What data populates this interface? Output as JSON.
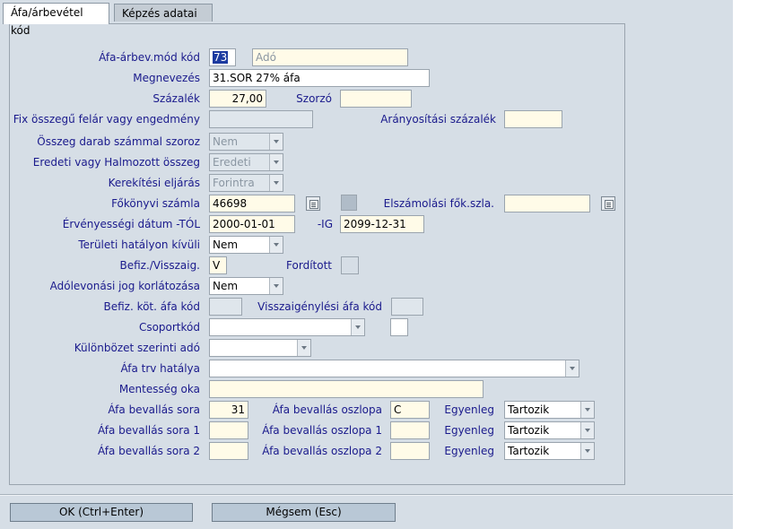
{
  "tabs": [
    {
      "label": "Áfa/árbevétel kód",
      "active": true
    },
    {
      "label": "Képzés adatai",
      "active": false
    }
  ],
  "form": {
    "afa_kod": {
      "label": "Áfa-árbev.mód kód",
      "value": "73",
      "type_value": "Adó"
    },
    "megnevezes": {
      "label": "Megnevezés",
      "value": "31.SOR 27% áfa"
    },
    "szazalek": {
      "label": "Százalék",
      "value": "27,00"
    },
    "szorzo": {
      "label": "Szorzó",
      "value": ""
    },
    "fix_osszegu": {
      "label": "Fix összegű felár vagy engedmény",
      "value": ""
    },
    "aranyositasi": {
      "label": "Arányosítási százalék",
      "value": ""
    },
    "osszeg_darab": {
      "label": "Összeg darab számmal szoroz",
      "value": "Nem"
    },
    "eredeti_halmozott": {
      "label": "Eredeti vagy Halmozott összeg",
      "value": "Eredeti"
    },
    "kerekitesi": {
      "label": "Kerekítési eljárás",
      "value": "Forintra"
    },
    "fokonyvi": {
      "label": "Főkönyvi számla",
      "value": "46698"
    },
    "elszamolasi": {
      "label": "Elszámolási fők.szla.",
      "value": ""
    },
    "ervenyesseg": {
      "label": "Érvényességi dátum -TÓL",
      "from": "2000-01-01",
      "to_label": "-IG",
      "to": "2099-12-31"
    },
    "teruleti": {
      "label": "Területi hatályon kívüli",
      "value": "Nem"
    },
    "befiz_visszaig": {
      "label": "Befiz./Visszaig.",
      "value": "V"
    },
    "forditott": {
      "label": "Fordított"
    },
    "adolevonasi": {
      "label": "Adólevonási jog korlátozása",
      "value": "Nem"
    },
    "befiz_kot": {
      "label": "Befiz. köt. áfa kód",
      "value": ""
    },
    "visszaigenylesi": {
      "label": "Visszaigénylési áfa kód",
      "value": ""
    },
    "csoportkod": {
      "label": "Csoportkód",
      "value": ""
    },
    "kulonbozet": {
      "label": "Különbözet szerinti adó",
      "value": ""
    },
    "afa_trv": {
      "label": "Áfa trv hatálya",
      "value": ""
    },
    "mentesseg": {
      "label": "Mentesség oka",
      "value": ""
    },
    "bevallas_rows": [
      {
        "sora_label": "Áfa bevallás sora",
        "sora": "31",
        "oszlopa_label": "Áfa bevallás oszlopa",
        "oszlopa": "C",
        "egyenleg_label": "Egyenleg",
        "egyenleg": "Tartozik"
      },
      {
        "sora_label": "Áfa bevallás sora 1",
        "sora": "",
        "oszlopa_label": "Áfa bevallás oszlopa 1",
        "oszlopa": "",
        "egyenleg_label": "Egyenleg",
        "egyenleg": "Tartozik"
      },
      {
        "sora_label": "Áfa bevallás sora 2",
        "sora": "",
        "oszlopa_label": "Áfa bevallás oszlopa 2",
        "oszlopa": "",
        "egyenleg_label": "Egyenleg",
        "egyenleg": "Tartozik"
      }
    ]
  },
  "buttons": {
    "ok": "OK (Ctrl+Enter)",
    "cancel": "Mégsem (Esc)"
  },
  "colors": {
    "label": "#1a1a8c",
    "field": "#fffbe8",
    "panel": "#d6dee6"
  }
}
